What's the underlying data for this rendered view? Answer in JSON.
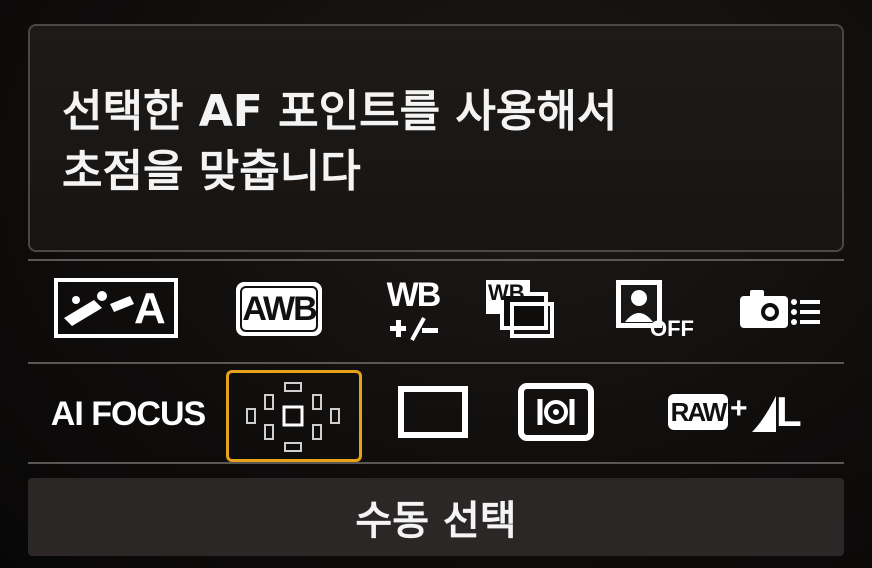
{
  "help": {
    "line1": "선택한 AF 포인트를 사용해서",
    "line2": "초점을 맞춥니다"
  },
  "icons_row": [
    {
      "name": "picture-style-auto-icon",
      "label": "A"
    },
    {
      "name": "awb-icon",
      "label": "AWB"
    },
    {
      "name": "wb-shift-icon",
      "label": "WB"
    },
    {
      "name": "wb-bracketing-icon",
      "label": "WB"
    },
    {
      "name": "peripheral-illumination-off-icon",
      "label": "OFF"
    },
    {
      "name": "camera-settings-icon",
      "label": ""
    }
  ],
  "settings_row": {
    "af_mode": "AI FOCUS",
    "af_point_mode": "manual-point-select",
    "quality_raw": "RAW",
    "quality_plus": "+",
    "quality_jpeg": "L"
  },
  "status": {
    "text": "수동 선택"
  },
  "colors": {
    "selection": "#e6a21b",
    "background": "#0d0b0a"
  }
}
